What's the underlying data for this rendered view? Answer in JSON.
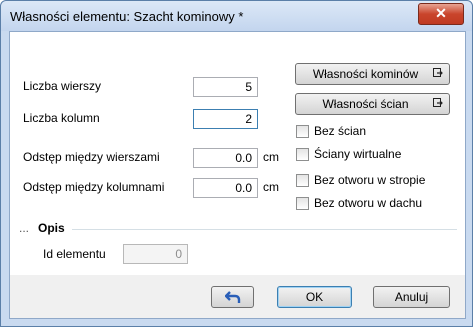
{
  "window": {
    "title": "Własności elementu: Szacht kominowy *",
    "close_glyph": "✕"
  },
  "fields": {
    "rows_label": "Liczba wierszy",
    "rows_value": "5",
    "cols_label": "Liczba kolumn",
    "cols_value": "2",
    "row_spacing_label": "Odstęp między wierszami",
    "row_spacing_value": "0.0",
    "row_spacing_unit": "cm",
    "col_spacing_label": "Odstęp między kolumnami",
    "col_spacing_value": "0.0",
    "col_spacing_unit": "cm"
  },
  "buttons": {
    "chimney_props": "Własności kominów",
    "wall_props": "Własności ścian"
  },
  "checkboxes": [
    "Bez ścian",
    "Ściany wirtualne",
    "Bez otworu w stropie",
    "Bez otworu w dachu"
  ],
  "section": {
    "prefix": "...",
    "title": "Opis"
  },
  "id_field": {
    "label": "Id elementu",
    "value": "0"
  },
  "footer": {
    "ok_label": "OK",
    "cancel_label": "Anuluj",
    "undo_icon": "undo-icon"
  },
  "colors": {
    "accent": "#3a6fc8",
    "close": "#c9452c"
  }
}
